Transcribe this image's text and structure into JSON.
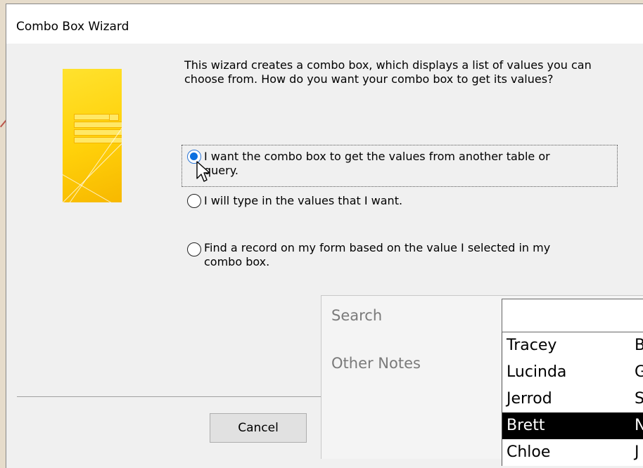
{
  "dialog": {
    "title": "Combo Box Wizard",
    "intro": "This wizard creates a combo box, which displays a list of values you can choose from.  How do you want your combo box to get its values?",
    "options": [
      {
        "label_line1": "I want the combo box to get the values from another table or",
        "label_line2": "query.",
        "checked": true
      },
      {
        "label_line1": "I will type in the values that I want.",
        "label_line2": "",
        "checked": false
      },
      {
        "label_line1": "Find a record on my form based on the value I selected in my",
        "label_line2": "combo box.",
        "checked": false
      }
    ],
    "cancel_label": "Cancel"
  },
  "overlay": {
    "search_label": "Search",
    "notes_label": "Other Notes",
    "search_value": "",
    "rows": [
      {
        "name": "Tracey",
        "col2": "B",
        "selected": false
      },
      {
        "name": "Lucinda",
        "col2": "G",
        "selected": false
      },
      {
        "name": "Jerrod",
        "col2": "S",
        "selected": false
      },
      {
        "name": "Brett",
        "col2": "N",
        "selected": true
      },
      {
        "name": "Chloe",
        "col2": "J",
        "selected": false
      }
    ]
  },
  "colors": {
    "radio_selected": "#0a6fe0",
    "illustration_yellow": "#ffd10a",
    "selected_row_bg": "#000000"
  }
}
